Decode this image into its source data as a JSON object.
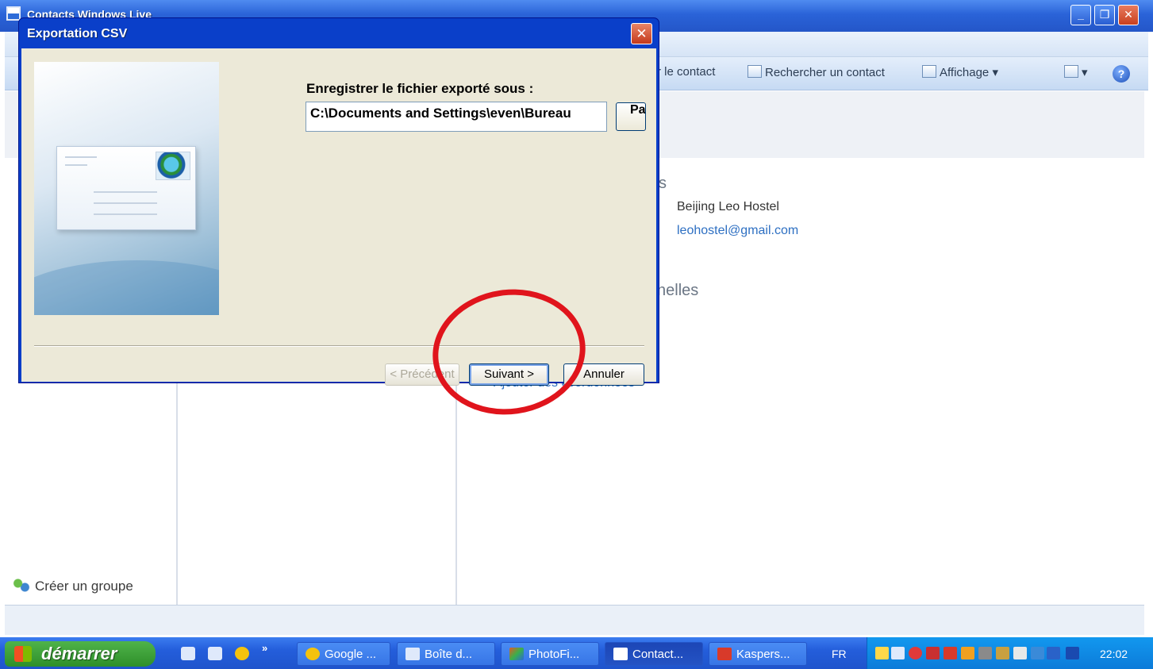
{
  "app": {
    "window_title": "Contacts Windows Live",
    "toolbar": {
      "contact_action": "r le contact",
      "search_contact": "Rechercher un contact",
      "view": "Affichage",
      "help_symbol": "?"
    },
    "section_partial_1": "s",
    "section_partial_2": "nelles",
    "contact": {
      "company": "Beijing Leo Hostel",
      "email": "leohostel@gmail.com"
    },
    "add_coordinates": "Ajouter des coordonnées",
    "create_group": "Créer un groupe"
  },
  "dialog": {
    "title": "Exportation CSV",
    "save_as_label": "Enregistrer le fichier exporté sous :",
    "path_value": "C:\\Documents and Settings\\even\\Bureau",
    "browse_label": "Pa",
    "buttons": {
      "previous": "< Précédent",
      "next": "Suivant >",
      "cancel": "Annuler"
    }
  },
  "taskbar": {
    "start_label": "démarrer",
    "quick_launch_more": "»",
    "tasks": [
      {
        "label": "Google ...",
        "icon": "chrome-icon",
        "color": "#f4c20d"
      },
      {
        "label": "Boîte d...",
        "icon": "mailbox-icon",
        "color": "#dfe9fb"
      },
      {
        "label": "PhotoFi...",
        "icon": "photofiltre-icon",
        "color": "#e05a2a"
      },
      {
        "label": "Contact...",
        "icon": "contacts-icon",
        "color": "#ffffff"
      },
      {
        "label": "Kaspers...",
        "icon": "kaspersky-icon",
        "color": "#d83a2a"
      }
    ],
    "language": "FR",
    "clock": "22:02"
  }
}
